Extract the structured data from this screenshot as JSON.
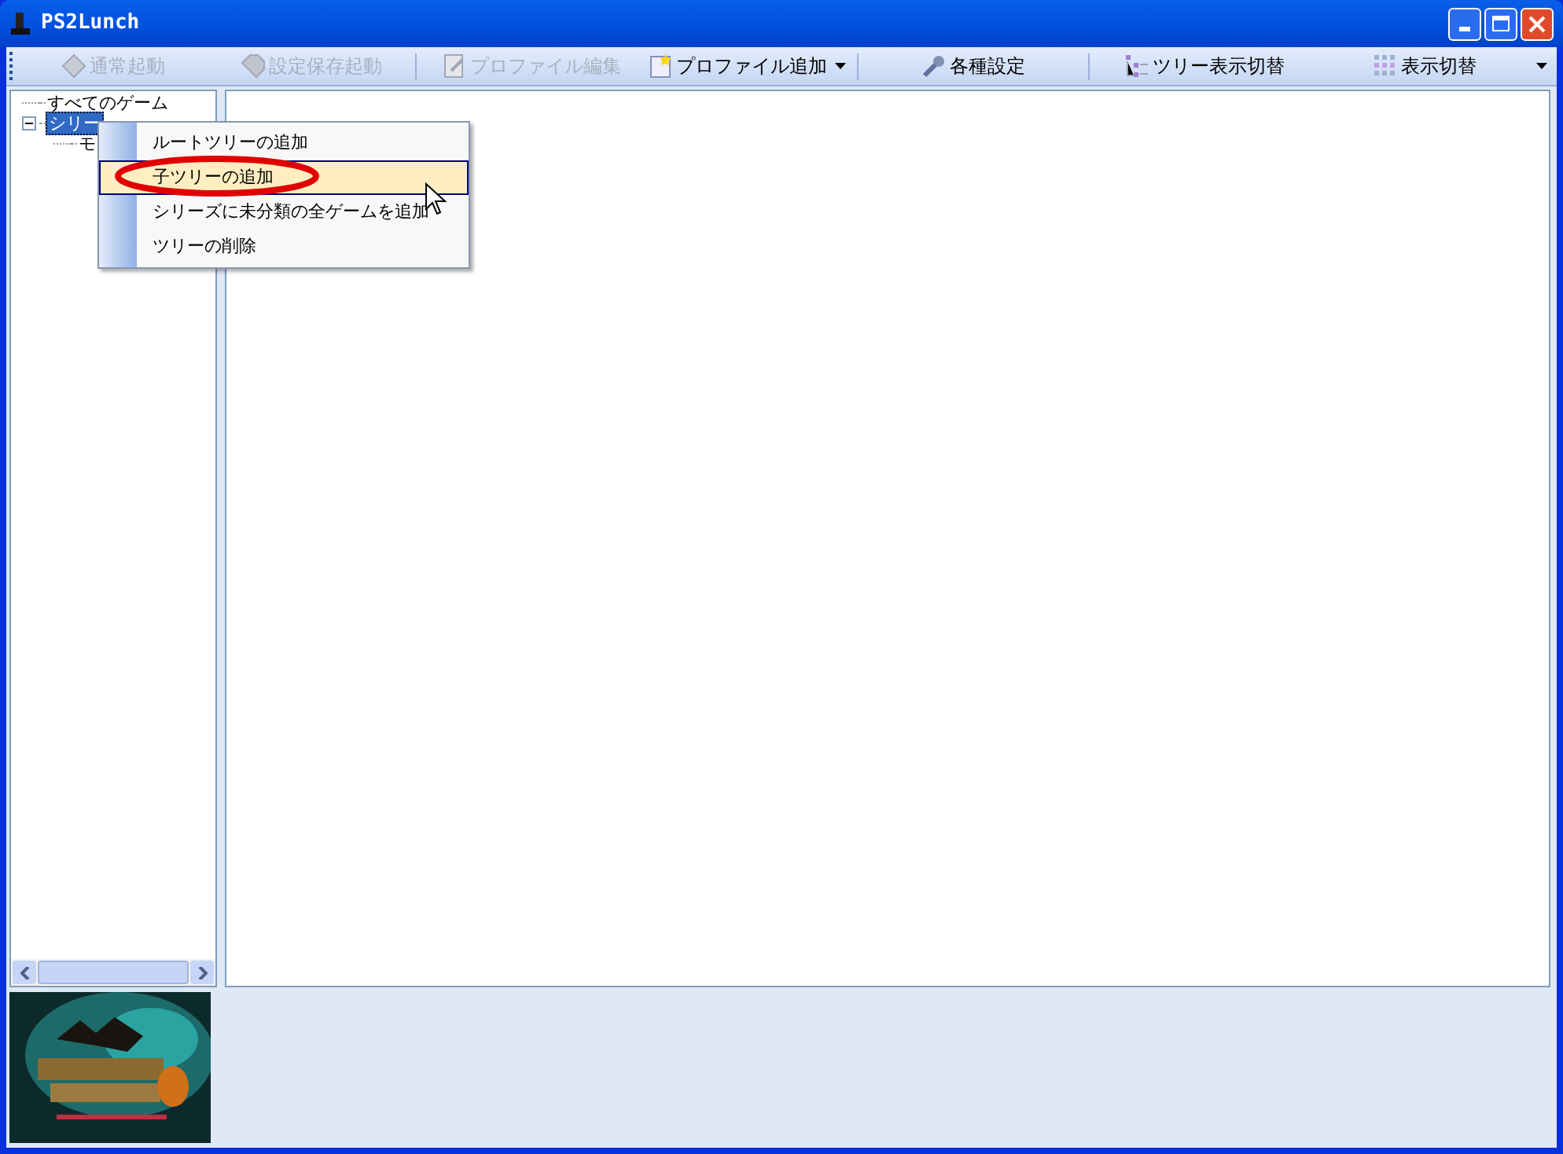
{
  "window": {
    "title": "PS2Lunch"
  },
  "toolbar": [
    {
      "kind": "button",
      "label": "通常起動",
      "disabled": true,
      "dropdown": false
    },
    {
      "kind": "button",
      "label": "設定保存起動",
      "disabled": true,
      "dropdown": false
    },
    {
      "kind": "separator"
    },
    {
      "kind": "button",
      "label": "プロファイル編集",
      "disabled": true,
      "dropdown": false
    },
    {
      "kind": "button",
      "label": "プロファイル追加",
      "disabled": false,
      "dropdown": true
    },
    {
      "kind": "separator"
    },
    {
      "kind": "button",
      "label": "各種設定",
      "disabled": false,
      "dropdown": false
    },
    {
      "kind": "separator"
    },
    {
      "kind": "button",
      "label": "ツリー表示切替",
      "disabled": false,
      "dropdown": false
    },
    {
      "kind": "button",
      "label": "表示切替",
      "disabled": false,
      "dropdown": false
    }
  ],
  "tree": [
    {
      "label": "すべてのゲーム",
      "selected": false
    },
    {
      "label": "シリー",
      "selected": true,
      "expanded": true,
      "children": [
        {
          "label": "モ",
          "selected": false
        }
      ]
    }
  ],
  "context_menu": {
    "items": [
      {
        "label": "ルートツリーの追加",
        "selected": false
      },
      {
        "label": "子ツリーの追加",
        "selected": true
      },
      {
        "label": "シリーズに未分類の全ゲームを追加",
        "selected": false
      },
      {
        "label": "ツリーの削除",
        "selected": false
      }
    ]
  }
}
